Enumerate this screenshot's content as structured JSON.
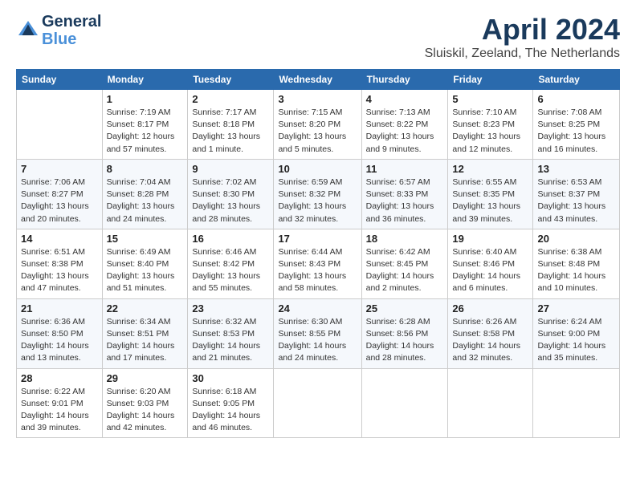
{
  "header": {
    "logo_line1": "General",
    "logo_line2": "Blue",
    "month_year": "April 2024",
    "location": "Sluiskil, Zeeland, The Netherlands"
  },
  "weekdays": [
    "Sunday",
    "Monday",
    "Tuesday",
    "Wednesday",
    "Thursday",
    "Friday",
    "Saturday"
  ],
  "weeks": [
    [
      {
        "day": "",
        "sunrise": "",
        "sunset": "",
        "daylight": ""
      },
      {
        "day": "1",
        "sunrise": "Sunrise: 7:19 AM",
        "sunset": "Sunset: 8:17 PM",
        "daylight": "Daylight: 12 hours and 57 minutes."
      },
      {
        "day": "2",
        "sunrise": "Sunrise: 7:17 AM",
        "sunset": "Sunset: 8:18 PM",
        "daylight": "Daylight: 13 hours and 1 minute."
      },
      {
        "day": "3",
        "sunrise": "Sunrise: 7:15 AM",
        "sunset": "Sunset: 8:20 PM",
        "daylight": "Daylight: 13 hours and 5 minutes."
      },
      {
        "day": "4",
        "sunrise": "Sunrise: 7:13 AM",
        "sunset": "Sunset: 8:22 PM",
        "daylight": "Daylight: 13 hours and 9 minutes."
      },
      {
        "day": "5",
        "sunrise": "Sunrise: 7:10 AM",
        "sunset": "Sunset: 8:23 PM",
        "daylight": "Daylight: 13 hours and 12 minutes."
      },
      {
        "day": "6",
        "sunrise": "Sunrise: 7:08 AM",
        "sunset": "Sunset: 8:25 PM",
        "daylight": "Daylight: 13 hours and 16 minutes."
      }
    ],
    [
      {
        "day": "7",
        "sunrise": "Sunrise: 7:06 AM",
        "sunset": "Sunset: 8:27 PM",
        "daylight": "Daylight: 13 hours and 20 minutes."
      },
      {
        "day": "8",
        "sunrise": "Sunrise: 7:04 AM",
        "sunset": "Sunset: 8:28 PM",
        "daylight": "Daylight: 13 hours and 24 minutes."
      },
      {
        "day": "9",
        "sunrise": "Sunrise: 7:02 AM",
        "sunset": "Sunset: 8:30 PM",
        "daylight": "Daylight: 13 hours and 28 minutes."
      },
      {
        "day": "10",
        "sunrise": "Sunrise: 6:59 AM",
        "sunset": "Sunset: 8:32 PM",
        "daylight": "Daylight: 13 hours and 32 minutes."
      },
      {
        "day": "11",
        "sunrise": "Sunrise: 6:57 AM",
        "sunset": "Sunset: 8:33 PM",
        "daylight": "Daylight: 13 hours and 36 minutes."
      },
      {
        "day": "12",
        "sunrise": "Sunrise: 6:55 AM",
        "sunset": "Sunset: 8:35 PM",
        "daylight": "Daylight: 13 hours and 39 minutes."
      },
      {
        "day": "13",
        "sunrise": "Sunrise: 6:53 AM",
        "sunset": "Sunset: 8:37 PM",
        "daylight": "Daylight: 13 hours and 43 minutes."
      }
    ],
    [
      {
        "day": "14",
        "sunrise": "Sunrise: 6:51 AM",
        "sunset": "Sunset: 8:38 PM",
        "daylight": "Daylight: 13 hours and 47 minutes."
      },
      {
        "day": "15",
        "sunrise": "Sunrise: 6:49 AM",
        "sunset": "Sunset: 8:40 PM",
        "daylight": "Daylight: 13 hours and 51 minutes."
      },
      {
        "day": "16",
        "sunrise": "Sunrise: 6:46 AM",
        "sunset": "Sunset: 8:42 PM",
        "daylight": "Daylight: 13 hours and 55 minutes."
      },
      {
        "day": "17",
        "sunrise": "Sunrise: 6:44 AM",
        "sunset": "Sunset: 8:43 PM",
        "daylight": "Daylight: 13 hours and 58 minutes."
      },
      {
        "day": "18",
        "sunrise": "Sunrise: 6:42 AM",
        "sunset": "Sunset: 8:45 PM",
        "daylight": "Daylight: 14 hours and 2 minutes."
      },
      {
        "day": "19",
        "sunrise": "Sunrise: 6:40 AM",
        "sunset": "Sunset: 8:46 PM",
        "daylight": "Daylight: 14 hours and 6 minutes."
      },
      {
        "day": "20",
        "sunrise": "Sunrise: 6:38 AM",
        "sunset": "Sunset: 8:48 PM",
        "daylight": "Daylight: 14 hours and 10 minutes."
      }
    ],
    [
      {
        "day": "21",
        "sunrise": "Sunrise: 6:36 AM",
        "sunset": "Sunset: 8:50 PM",
        "daylight": "Daylight: 14 hours and 13 minutes."
      },
      {
        "day": "22",
        "sunrise": "Sunrise: 6:34 AM",
        "sunset": "Sunset: 8:51 PM",
        "daylight": "Daylight: 14 hours and 17 minutes."
      },
      {
        "day": "23",
        "sunrise": "Sunrise: 6:32 AM",
        "sunset": "Sunset: 8:53 PM",
        "daylight": "Daylight: 14 hours and 21 minutes."
      },
      {
        "day": "24",
        "sunrise": "Sunrise: 6:30 AM",
        "sunset": "Sunset: 8:55 PM",
        "daylight": "Daylight: 14 hours and 24 minutes."
      },
      {
        "day": "25",
        "sunrise": "Sunrise: 6:28 AM",
        "sunset": "Sunset: 8:56 PM",
        "daylight": "Daylight: 14 hours and 28 minutes."
      },
      {
        "day": "26",
        "sunrise": "Sunrise: 6:26 AM",
        "sunset": "Sunset: 8:58 PM",
        "daylight": "Daylight: 14 hours and 32 minutes."
      },
      {
        "day": "27",
        "sunrise": "Sunrise: 6:24 AM",
        "sunset": "Sunset: 9:00 PM",
        "daylight": "Daylight: 14 hours and 35 minutes."
      }
    ],
    [
      {
        "day": "28",
        "sunrise": "Sunrise: 6:22 AM",
        "sunset": "Sunset: 9:01 PM",
        "daylight": "Daylight: 14 hours and 39 minutes."
      },
      {
        "day": "29",
        "sunrise": "Sunrise: 6:20 AM",
        "sunset": "Sunset: 9:03 PM",
        "daylight": "Daylight: 14 hours and 42 minutes."
      },
      {
        "day": "30",
        "sunrise": "Sunrise: 6:18 AM",
        "sunset": "Sunset: 9:05 PM",
        "daylight": "Daylight: 14 hours and 46 minutes."
      },
      {
        "day": "",
        "sunrise": "",
        "sunset": "",
        "daylight": ""
      },
      {
        "day": "",
        "sunrise": "",
        "sunset": "",
        "daylight": ""
      },
      {
        "day": "",
        "sunrise": "",
        "sunset": "",
        "daylight": ""
      },
      {
        "day": "",
        "sunrise": "",
        "sunset": "",
        "daylight": ""
      }
    ]
  ]
}
